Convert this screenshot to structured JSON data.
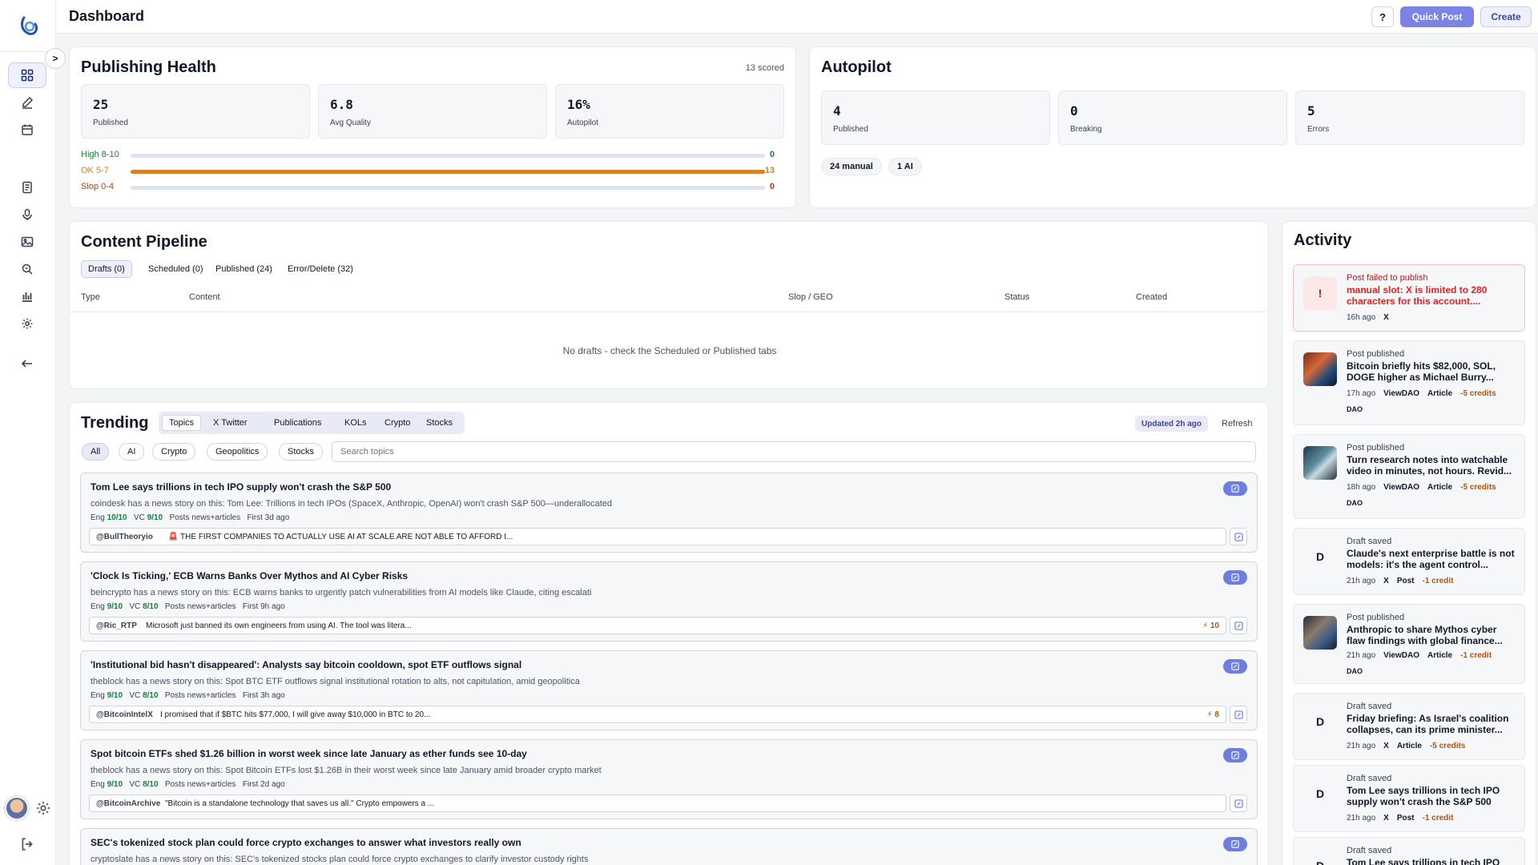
{
  "header": {
    "title": "Dashboard",
    "help": "?",
    "quick_post": "Quick Post",
    "create": "Create"
  },
  "sidebar": {
    "collapse": ">"
  },
  "health": {
    "title": "Publishing Health",
    "scored": "13 scored",
    "stats": [
      {
        "value": "25",
        "label": "Published"
      },
      {
        "value": "6.8",
        "label": "Avg Quality"
      },
      {
        "value": "16%",
        "label": "Autopilot"
      }
    ],
    "bars": [
      {
        "label": "High 8-10",
        "value": "0",
        "fraction": 0,
        "color": "#15803d"
      },
      {
        "label": "OK 5-7",
        "value": "13",
        "fraction": 1,
        "color": "#d97f28"
      },
      {
        "label": "Slop 0-4",
        "value": "0",
        "fraction": 0,
        "color": "#c2410c"
      }
    ]
  },
  "autopilot": {
    "title": "Autopilot",
    "stats": [
      {
        "value": "4",
        "label": "Published"
      },
      {
        "value": "0",
        "label": "Breaking"
      },
      {
        "value": "5",
        "label": "Errors"
      }
    ],
    "pills": [
      "24 manual",
      "1 AI"
    ]
  },
  "pipeline": {
    "title": "Content Pipeline",
    "tabs": [
      "Drafts (0)",
      "Scheduled (0)",
      "Published (24)",
      "Error/Delete (32)"
    ],
    "columns": [
      "Type",
      "Content",
      "Slop / GEO",
      "Status",
      "Created"
    ],
    "empty": "No drafts - check the Scheduled or Published tabs"
  },
  "trending": {
    "title": "Trending",
    "tabs": [
      "Topics",
      "X Twitter",
      "Publications",
      "KOLs",
      "Crypto",
      "Stocks"
    ],
    "updated": "Updated 2h ago",
    "refresh": "Refresh",
    "chips": [
      "All",
      "AI",
      "Crypto",
      "Geopolitics",
      "Stocks"
    ],
    "search_placeholder": "Search topics",
    "topics": [
      {
        "title": "Tom Lee says trillions in tech IPO supply won't crash the S&P 500",
        "desc": "coindesk has a news story on this: Tom Lee: Trillions in tech IPOs (SpaceX, Anthropic, OpenAI) won't crash S&P 500—underallocated",
        "eng_label": "Eng",
        "eng": "10/10",
        "vc_label": "VC",
        "vc": "9/10",
        "posts": "Posts news+articles",
        "first": "First 3d ago",
        "handle": "@BullTheoryio",
        "tweet": "🚨 THE FIRST COMPANIES TO ACTUALLY USE AI AT SCALE ARE NOT ABLE TO AFFORD I...",
        "score": ""
      },
      {
        "title": "'Clock Is Ticking,' ECB Warns Banks Over Mythos and AI Cyber Risks",
        "desc": "beincrypto has a news story on this: ECB warns banks to urgently patch vulnerabilities from AI models like Claude, citing escalati",
        "eng_label": "Eng",
        "eng": "9/10",
        "vc_label": "VC",
        "vc": "8/10",
        "posts": "Posts news+articles",
        "first": "First 9h ago",
        "handle": "@Ric_RTP",
        "tweet": "Microsoft just banned its own engineers from using AI. The tool was litera...",
        "score": "⚡ 10"
      },
      {
        "title": "'Institutional bid hasn't disappeared': Analysts say bitcoin cooldown, spot ETF outflows signal",
        "desc": "theblock has a news story on this: Spot BTC ETF outflows signal institutional rotation to alts, not capitulation, amid geopolitica",
        "eng_label": "Eng",
        "eng": "9/10",
        "vc_label": "VC",
        "vc": "8/10",
        "posts": "Posts news+articles",
        "first": "First 3h ago",
        "handle": "@BitcoinIntelX",
        "tweet": "I promised that if $BTC hits $77,000, I will give away $10,000 in BTC to 20...",
        "score": "⚡ 8"
      },
      {
        "title": "Spot bitcoin ETFs shed $1.26 billion in worst week since late January as ether funds see 10-day",
        "desc": "theblock has a news story on this: Spot Bitcoin ETFs lost $1.26B in their worst week since late January amid broader crypto market",
        "eng_label": "Eng",
        "eng": "9/10",
        "vc_label": "VC",
        "vc": "8/10",
        "posts": "Posts news+articles",
        "first": "First 2d ago",
        "handle": "@BitcoinArchive",
        "tweet": "\"Bitcoin is a standalone technology that saves us all.\" Crypto empowers a ...",
        "score": ""
      },
      {
        "title": "SEC's tokenized stock plan could force crypto exchanges to answer what investors really own",
        "desc": "cryptoslate has a news story on this: SEC's tokenized stocks plan could force crypto exchanges to clarify investor custody rights",
        "eng_label": "",
        "eng": "",
        "vc_label": "",
        "vc": "",
        "posts": "",
        "first": "",
        "handle": "",
        "tweet": "",
        "score": ""
      }
    ]
  },
  "activity": {
    "title": "Activity",
    "items": [
      {
        "kind": "Post failed to publish",
        "title": "manual slot: X is limited to 280 characters for this account....",
        "time": "16h ago",
        "platform": "X",
        "type": "",
        "credits": "",
        "dao": "",
        "icon": "!",
        "status": "error"
      },
      {
        "kind": "Post published",
        "title": "Bitcoin briefly hits $82,000, SOL, DOGE higher as Michael Burry...",
        "time": "17h ago",
        "platform": "ViewDAO",
        "type": "Article",
        "credits": "-5 credits",
        "dao": "DAO",
        "icon": "thumb",
        "status": "ok"
      },
      {
        "kind": "Post published",
        "title": "Turn research notes into watchable video in minutes, not hours. Revid...",
        "time": "18h ago",
        "platform": "ViewDAO",
        "type": "Article",
        "credits": "-5 credits",
        "dao": "DAO",
        "icon": "thumb",
        "status": "ok"
      },
      {
        "kind": "Draft saved",
        "title": "Claude's next enterprise battle is not models: it's the agent control...",
        "time": "21h ago",
        "platform": "X",
        "type": "Post",
        "credits": "-1 credit",
        "dao": "",
        "icon": "D",
        "status": "draft"
      },
      {
        "kind": "Post published",
        "title": "Anthropic to share Mythos cyber flaw findings with global finance...",
        "time": "21h ago",
        "platform": "ViewDAO",
        "type": "Article",
        "credits": "-1 credit",
        "dao": "DAO",
        "icon": "thumb",
        "status": "ok"
      },
      {
        "kind": "Draft saved",
        "title": "Friday briefing: As Israel's coalition collapses, can its prime minister...",
        "time": "21h ago",
        "platform": "X",
        "type": "Article",
        "credits": "-5 credits",
        "dao": "",
        "icon": "D",
        "status": "draft"
      },
      {
        "kind": "Draft saved",
        "title": "Tom Lee says trillions in tech IPO supply won't crash the S&P 500",
        "time": "21h ago",
        "platform": "X",
        "type": "Post",
        "credits": "-1 credit",
        "dao": "",
        "icon": "D",
        "status": "draft"
      },
      {
        "kind": "Draft saved",
        "title": "Tom Lee says trillions in tech IPO",
        "time": "",
        "platform": "",
        "type": "",
        "credits": "",
        "dao": "",
        "icon": "D",
        "status": "draft"
      }
    ]
  }
}
